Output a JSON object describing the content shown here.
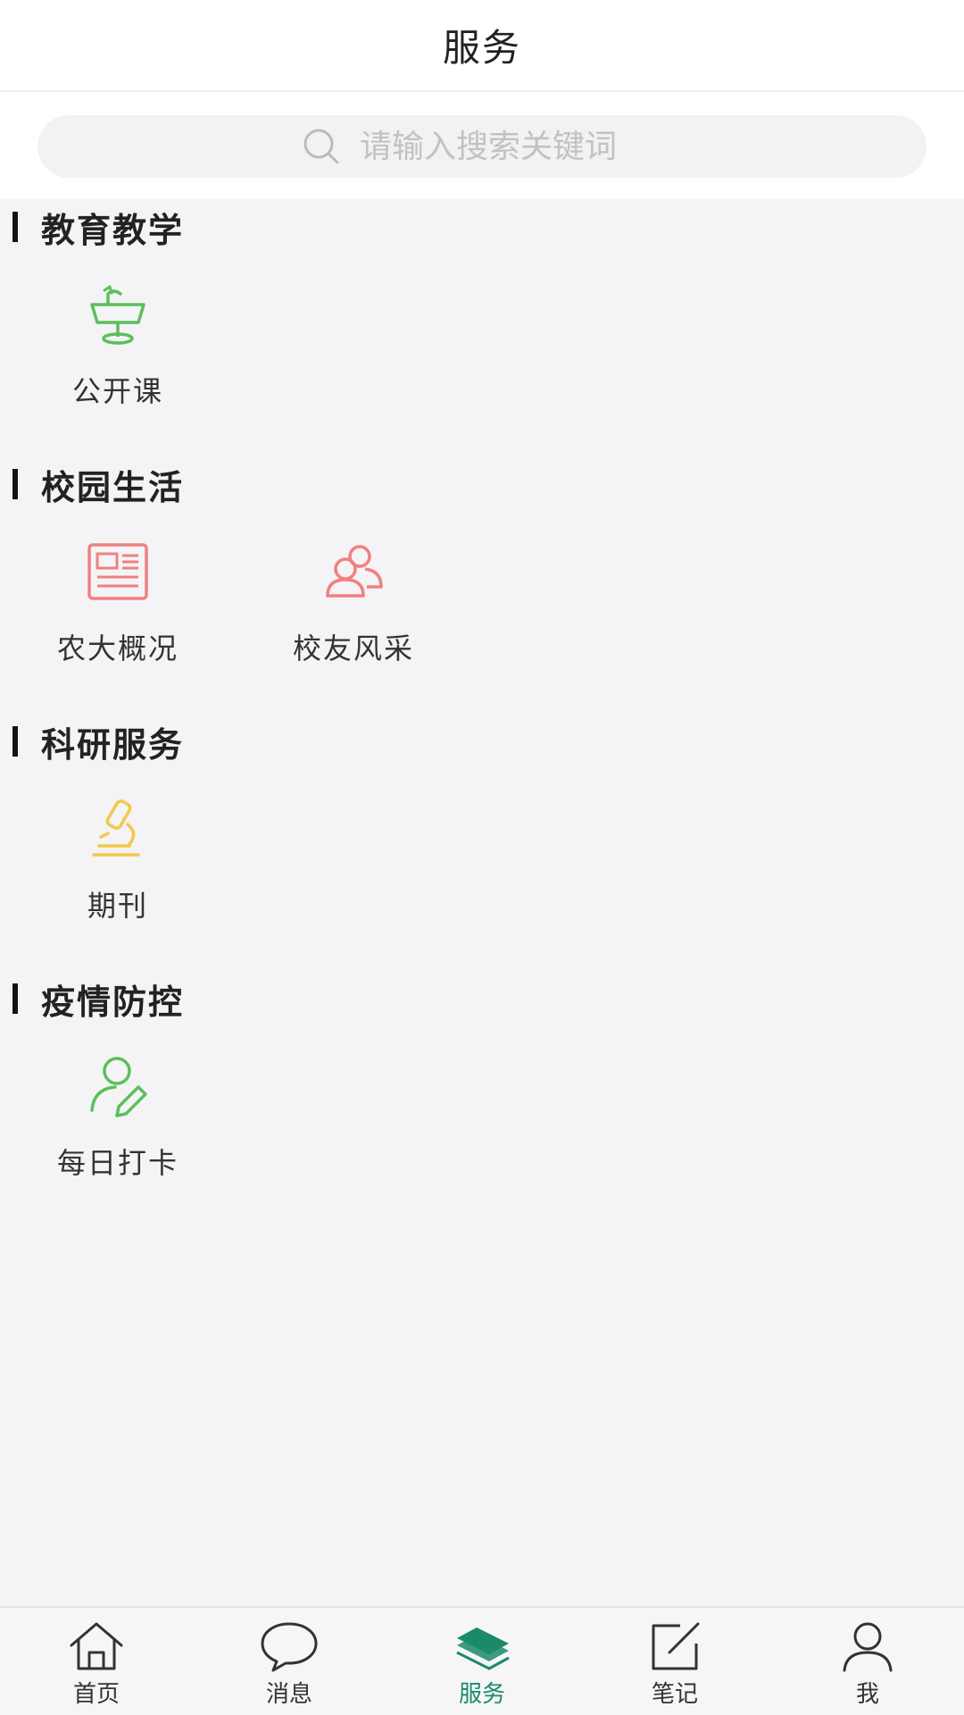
{
  "header": {
    "title": "服务"
  },
  "search": {
    "placeholder": "请输入搜索关键词"
  },
  "sections": [
    {
      "title": "教育教学",
      "items": [
        {
          "label": "公开课",
          "icon": "keynote-podium-icon"
        }
      ]
    },
    {
      "title": "校园生活",
      "items": [
        {
          "label": "农大概况",
          "icon": "newspaper-icon"
        },
        {
          "label": "校友风采",
          "icon": "users-group-icon"
        }
      ]
    },
    {
      "title": "科研服务",
      "items": [
        {
          "label": "期刊",
          "icon": "microscope-icon"
        }
      ]
    },
    {
      "title": "疫情防控",
      "items": [
        {
          "label": "每日打卡",
          "icon": "user-edit-icon"
        }
      ]
    }
  ],
  "tabbar": {
    "items": [
      {
        "label": "首页",
        "icon": "home-icon",
        "active": false
      },
      {
        "label": "消息",
        "icon": "chat-bubble-icon",
        "active": false
      },
      {
        "label": "服务",
        "icon": "layers-icon",
        "active": true
      },
      {
        "label": "笔记",
        "icon": "note-edit-icon",
        "active": false
      },
      {
        "label": "我",
        "icon": "user-icon",
        "active": false
      }
    ]
  },
  "colors": {
    "accent": "#1b8a6b",
    "green_icon": "#5cbf5a",
    "red_icon": "#f08080",
    "yellow_icon": "#f2c94c"
  }
}
